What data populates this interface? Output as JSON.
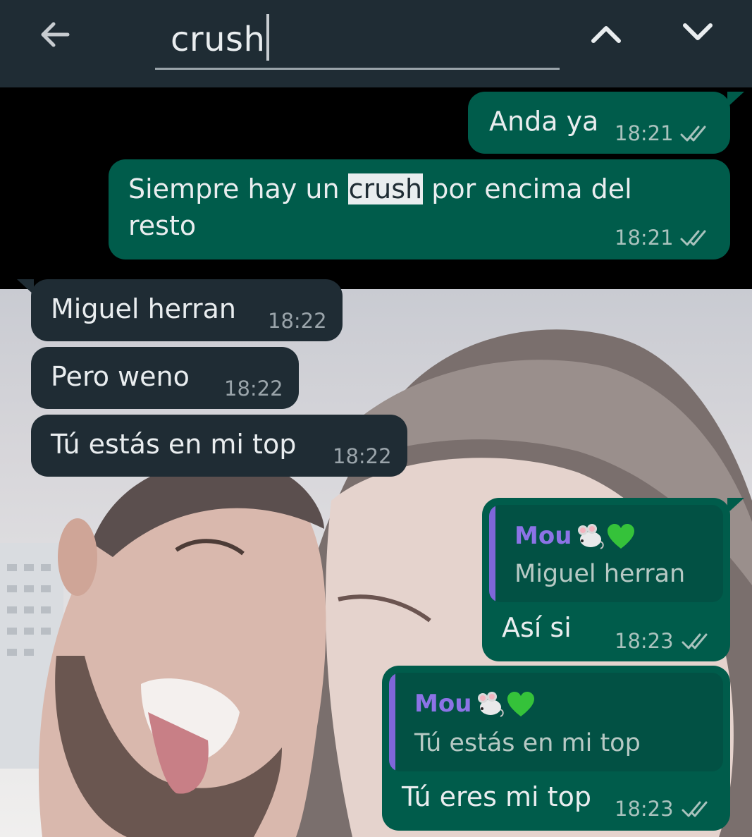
{
  "search": {
    "query": "crush"
  },
  "messages": [
    {
      "direction": "out",
      "text": "Anda ya",
      "time": "18:21"
    },
    {
      "direction": "out",
      "text_before": "Siempre hay un ",
      "highlight": "crush",
      "text_after": " por encima del",
      "text_line2": "resto",
      "time": "18:21"
    },
    {
      "direction": "in",
      "text": "Miguel herran",
      "time": "18:22"
    },
    {
      "direction": "in",
      "text": "Pero weno",
      "time": "18:22"
    },
    {
      "direction": "in",
      "text": "Tú estás en mi top",
      "time": "18:22"
    },
    {
      "direction": "out",
      "quote_author": "Mou",
      "quote_text": "Miguel herran",
      "text": "Así si",
      "time": "18:23"
    },
    {
      "direction": "out",
      "quote_author": "Mou",
      "quote_text": "Tú estás en mi top",
      "text": "Tú eres mi top",
      "time": "18:23"
    }
  ],
  "colors": {
    "header": "#1f2c34",
    "outgoing_bubble": "#005c4b",
    "incoming_bubble": "#1f2c34",
    "quote_accent": "#7f66d9",
    "read_ticks": "#a9c2bd"
  }
}
